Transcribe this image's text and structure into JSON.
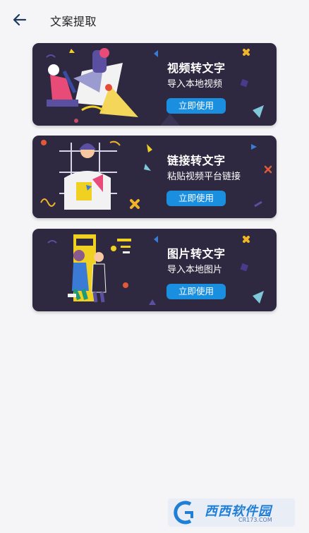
{
  "header": {
    "title": "文案提取",
    "back_icon": "arrow-left-icon"
  },
  "cards": [
    {
      "title": "视频转文字",
      "subtitle": "导入本地视频",
      "button": "立即使用"
    },
    {
      "title": "链接转文字",
      "subtitle": "粘贴视频平台链接",
      "button": "立即使用"
    },
    {
      "title": "图片转文字",
      "subtitle": "导入本地图片",
      "button": "立即使用"
    }
  ],
  "watermark": {
    "brand": "西西软件园",
    "domain": "CR173.COM"
  },
  "colors": {
    "background": "#f5f5f7",
    "card": "#2e2940",
    "button": "#1a8fe0"
  }
}
